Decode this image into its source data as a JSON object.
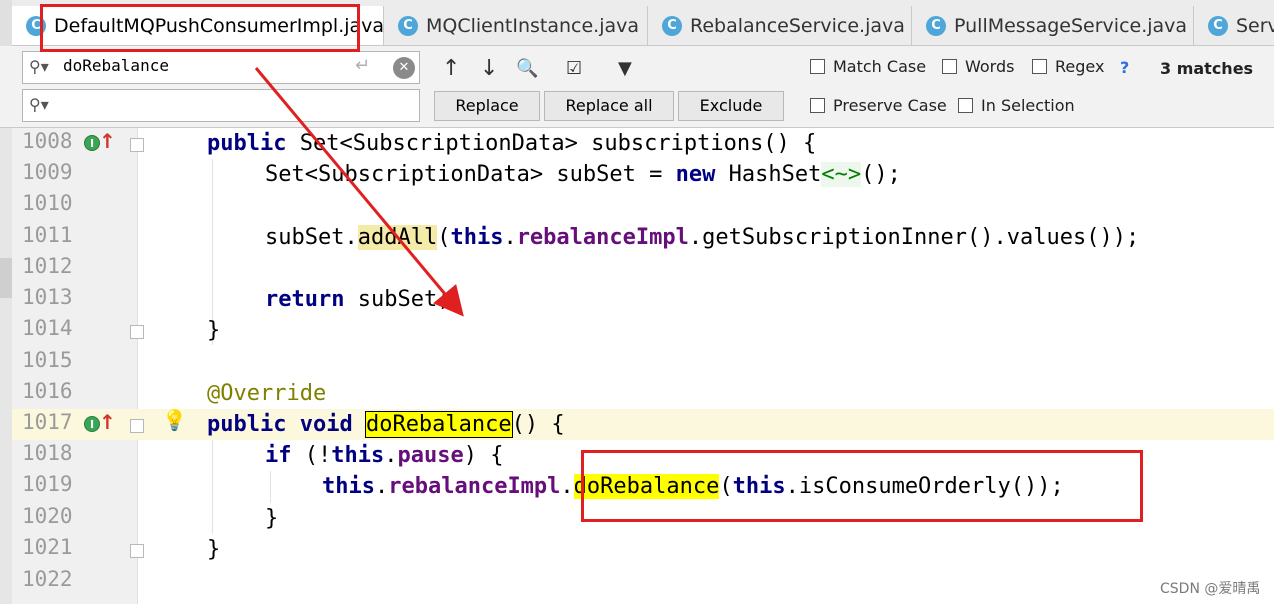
{
  "tabs": [
    {
      "label": "DefaultMQPushConsumerImpl.java",
      "icon": "C",
      "active": true
    },
    {
      "label": "MQClientInstance.java",
      "icon": "C",
      "active": false
    },
    {
      "label": "RebalanceService.java",
      "icon": "C",
      "active": false
    },
    {
      "label": "PullMessageService.java",
      "icon": "C",
      "active": false
    },
    {
      "label": "Serv",
      "icon": "C",
      "active": false
    }
  ],
  "tab_close_glyph": "×",
  "search": {
    "find_value": "doRebalance",
    "replace_value": "",
    "enter_icon": "↵",
    "clear_icon": "✕",
    "tools": [
      "↑",
      "↓",
      "🔍",
      "☑",
      "▼"
    ],
    "buttons": {
      "replace": "Replace",
      "replace_all": "Replace all",
      "exclude": "Exclude"
    },
    "options": {
      "match_case": "Match Case",
      "words": "Words",
      "regex": "Regex",
      "preserve_case": "Preserve Case",
      "in_selection": "In Selection"
    },
    "help": "?",
    "matches": "3 matches"
  },
  "editor": {
    "lines": [
      "1008",
      "1009",
      "1010",
      "1011",
      "1012",
      "1013",
      "1014",
      "1015",
      "1016",
      "1017",
      "1018",
      "1019",
      "1020",
      "1021",
      "1022"
    ],
    "code": {
      "l1008": {
        "kw": "public",
        "rest": " Set<SubscriptionData> subscriptions() {"
      },
      "l1009": {
        "a": "Set<SubscriptionData> subSet = ",
        "kw": "new",
        "b": " HashSet",
        "gen": "<~>",
        "c": "();"
      },
      "l1011": {
        "a": "subSet.",
        "hl": "addAll",
        "b": "(",
        "kw": "this",
        "c": ".",
        "fld": "rebalanceImpl",
        "d": ".getSubscriptionInner().values());"
      },
      "l1013": {
        "kw": "return",
        "rest": " subSet;"
      },
      "l1014": "}",
      "l1016": "@Override",
      "l1017": {
        "kw": "public void",
        "sp": " ",
        "hl": "doRebalance",
        "rest": "() {"
      },
      "l1018": {
        "kw": "if",
        "a": " (!",
        "kw2": "this",
        "b": ".",
        "fld": "pause",
        "c": ") {"
      },
      "l1019": {
        "kw": "this",
        "a": ".",
        "fld": "rebalanceImpl",
        "b": ".",
        "hl": "doRebalance",
        "c": "(",
        "kw2": "this",
        "d": ".isConsumeOrderly());"
      },
      "l1020": "}",
      "l1021": "}"
    },
    "override_icon": "I",
    "override_arrow": "↑",
    "bulb_icon": "💡"
  },
  "watermark": "CSDN @爱晴禹"
}
